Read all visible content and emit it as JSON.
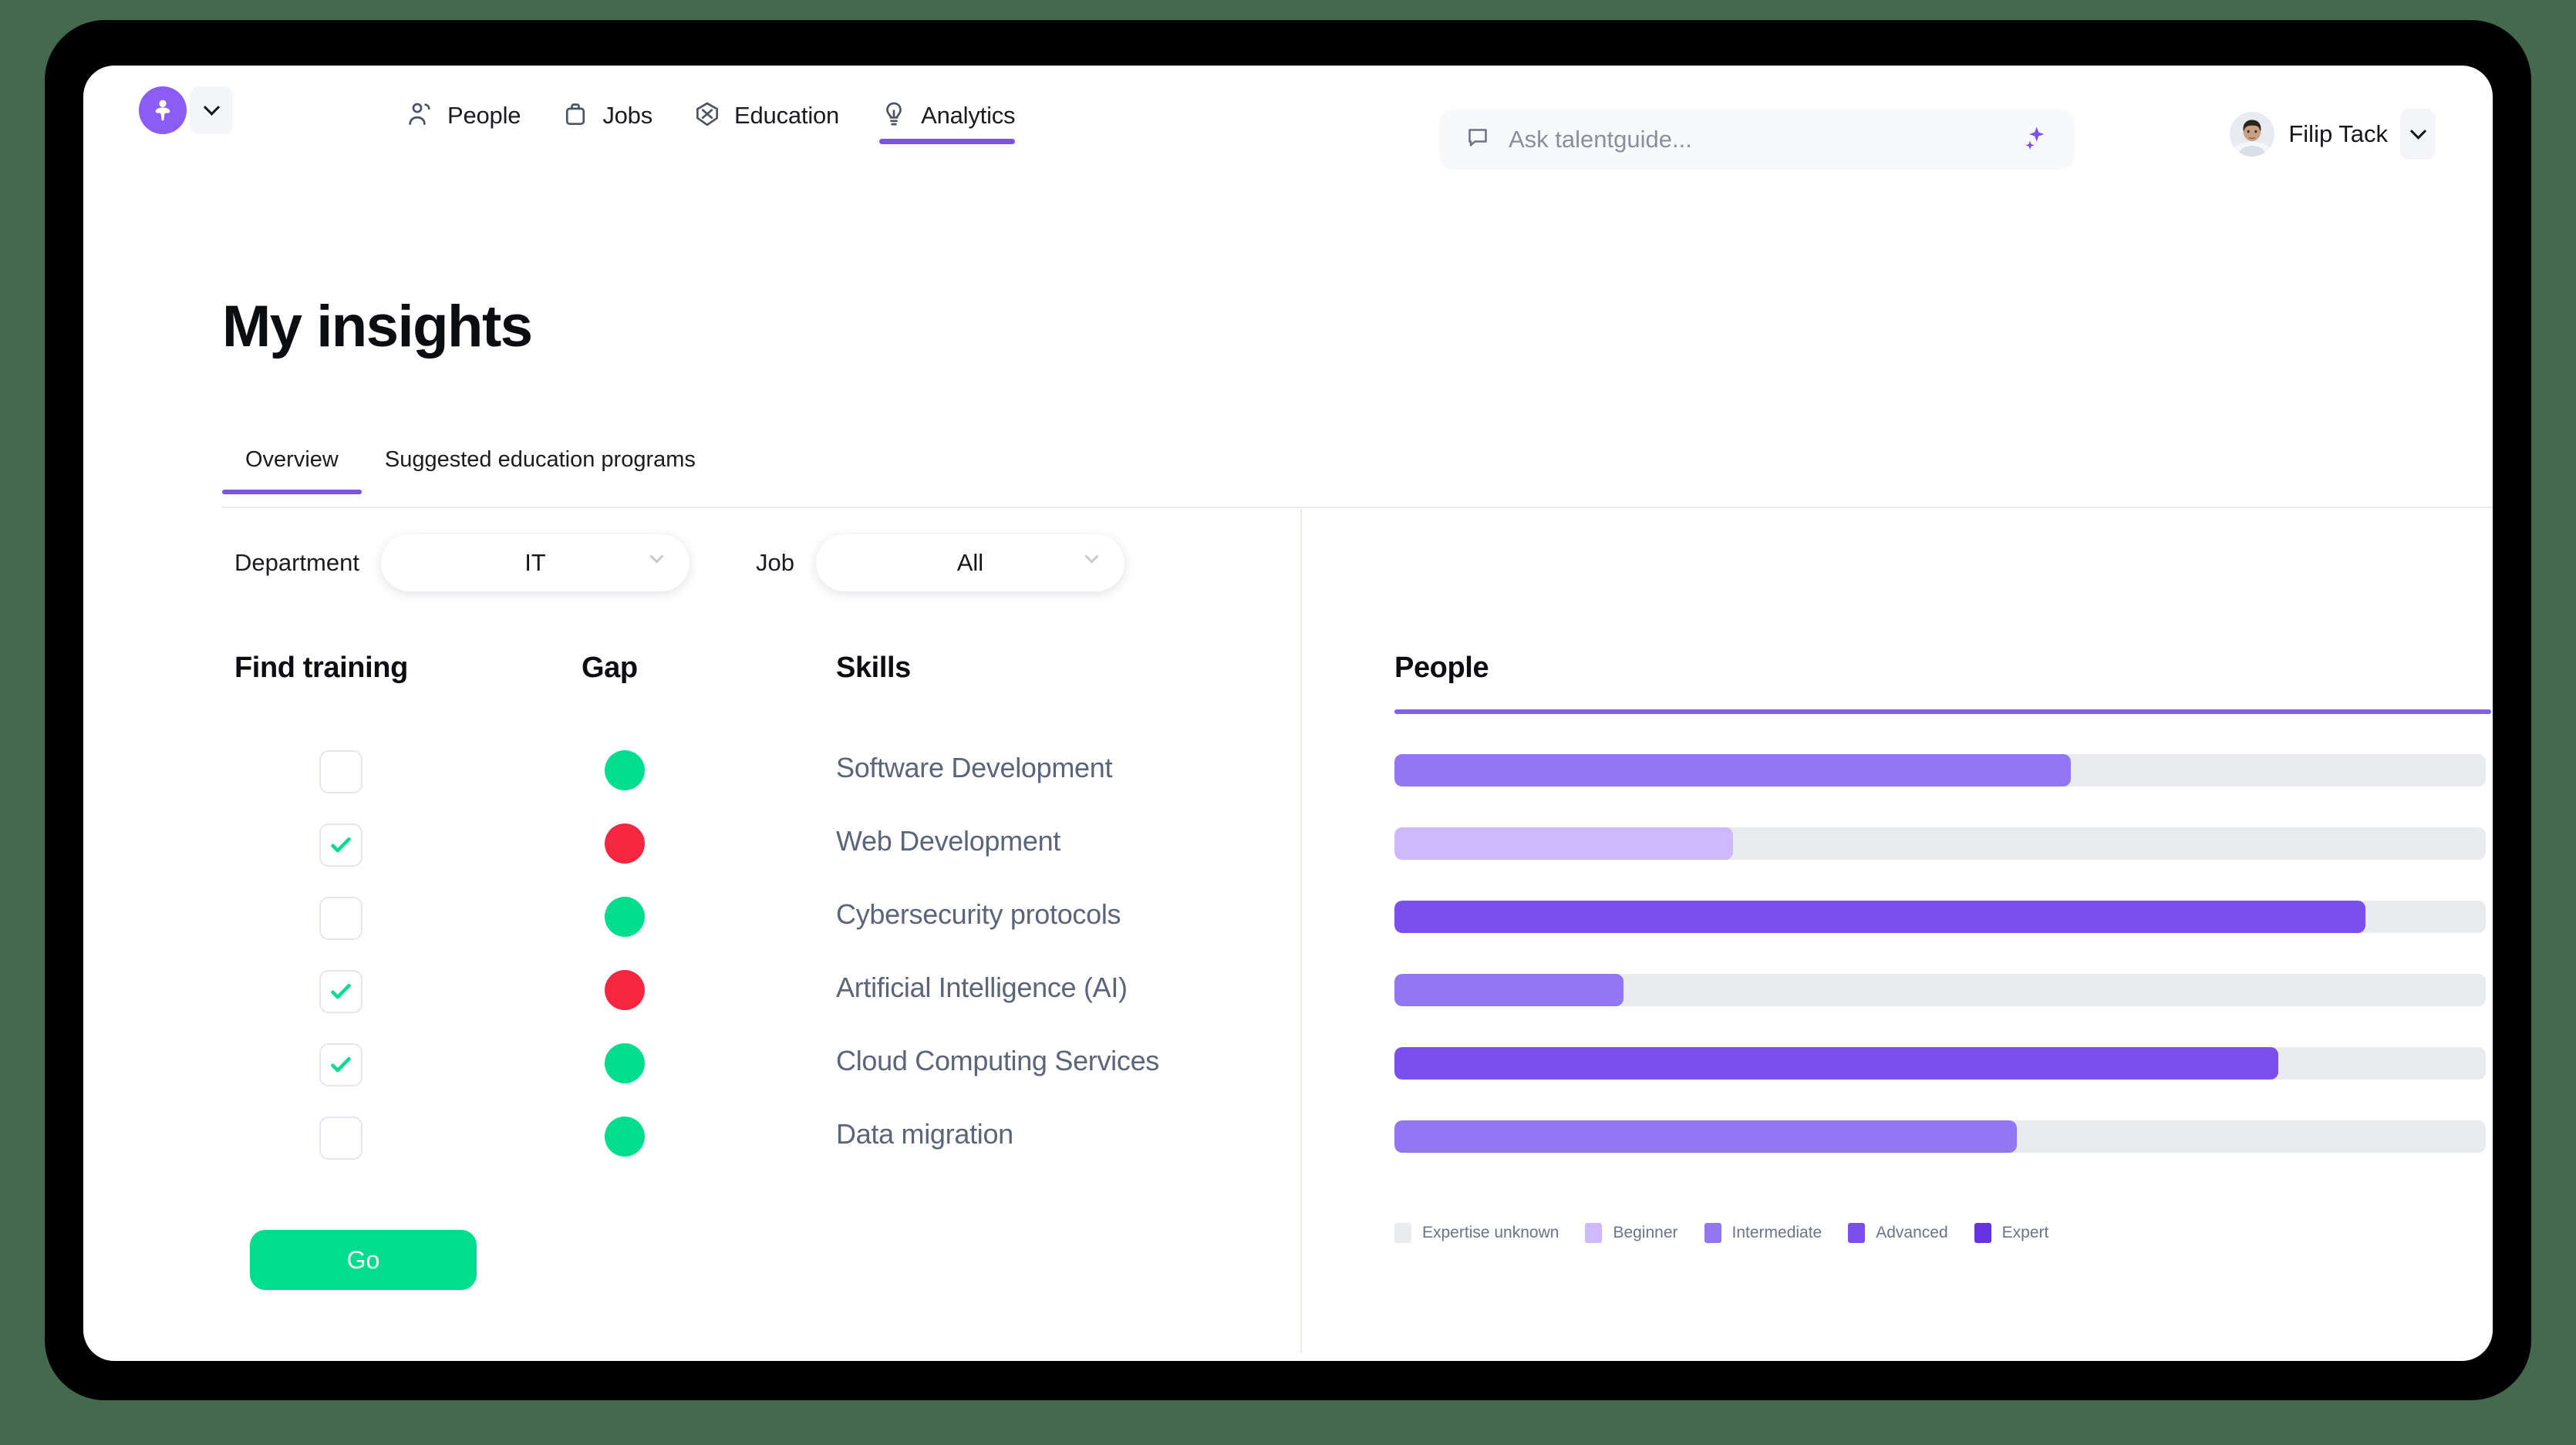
{
  "colors": {
    "brand_purple": "#8b5cf6",
    "nav_underline": "#7b52e8",
    "go_green": "#00dd8e",
    "gap_ok": "#00dd8e",
    "gap_bad": "#f5263f",
    "track": "#eaebef",
    "desktop_bg": "#44694e"
  },
  "topnav": {
    "logo_icon": "talentguide-logo-icon",
    "logo_caret_icon": "chevron-down-icon",
    "items": [
      {
        "label": "People",
        "icon": "people-icon",
        "active": false
      },
      {
        "label": "Jobs",
        "icon": "briefcase-icon",
        "active": false
      },
      {
        "label": "Education",
        "icon": "graduation-cap-icon",
        "active": false
      },
      {
        "label": "Analytics",
        "icon": "lightbulb-icon",
        "active": true
      }
    ]
  },
  "search": {
    "icon": "chat-bubble-icon",
    "placeholder": "Ask talentguide...",
    "value": "",
    "sparkle_icon": "sparkle-icon"
  },
  "profile": {
    "avatar_icon": "user-avatar",
    "name": "Filip Tack",
    "caret_icon": "chevron-down-icon"
  },
  "page": {
    "title": "My insights",
    "tabs": [
      {
        "label": "Overview",
        "active": true
      },
      {
        "label": "Suggested education programs",
        "active": false
      }
    ]
  },
  "filters": [
    {
      "label": "Department",
      "value": "IT",
      "caret_icon": "chevron-down-icon"
    },
    {
      "label": "Job",
      "value": "All",
      "caret_icon": "chevron-down-icon"
    }
  ],
  "skills_table": {
    "headers": [
      "Find training",
      "Gap",
      "Skills"
    ],
    "rows": [
      {
        "checked": false,
        "gap": "ok",
        "skill": "Software Development"
      },
      {
        "checked": true,
        "gap": "bad",
        "skill": "Web Development"
      },
      {
        "checked": false,
        "gap": "ok",
        "skill": "Cybersecurity protocols"
      },
      {
        "checked": true,
        "gap": "bad",
        "skill": "Artificial Intelligence (AI)"
      },
      {
        "checked": true,
        "gap": "ok",
        "skill": "Cloud Computing Services"
      },
      {
        "checked": false,
        "gap": "ok",
        "skill": "Data migration"
      }
    ],
    "go_label": "Go"
  },
  "people_panel": {
    "title": "People",
    "legend": [
      {
        "label": "Expertise unknown",
        "color": "#eaebef"
      },
      {
        "label": "Beginner",
        "color": "#cdb9fb"
      },
      {
        "label": "Intermediate",
        "color": "#9277f5"
      },
      {
        "label": "Advanced",
        "color": "#7a4fee"
      },
      {
        "label": "Expert",
        "color": "#6633e0"
      }
    ]
  },
  "chart_data": {
    "type": "bar",
    "title": "People",
    "orientation": "horizontal",
    "xlabel": "",
    "ylabel": "",
    "xlim": [
      0,
      100
    ],
    "grid": false,
    "legend_position": "bottom-left",
    "categories": [
      "Software Development",
      "Web Development",
      "Cybersecurity protocols",
      "Artificial Intelligence (AI)",
      "Cloud Computing Services",
      "Data migration"
    ],
    "values": [
      62,
      31,
      89,
      21,
      81,
      57
    ],
    "levels": [
      "Intermediate",
      "Beginner",
      "Advanced",
      "Intermediate",
      "Advanced",
      "Intermediate"
    ],
    "bar_colors": [
      "#9277f5",
      "#cdb9fb",
      "#7a4fee",
      "#9277f5",
      "#7a4fee",
      "#9277f5"
    ],
    "track_color": "#eaebef"
  }
}
